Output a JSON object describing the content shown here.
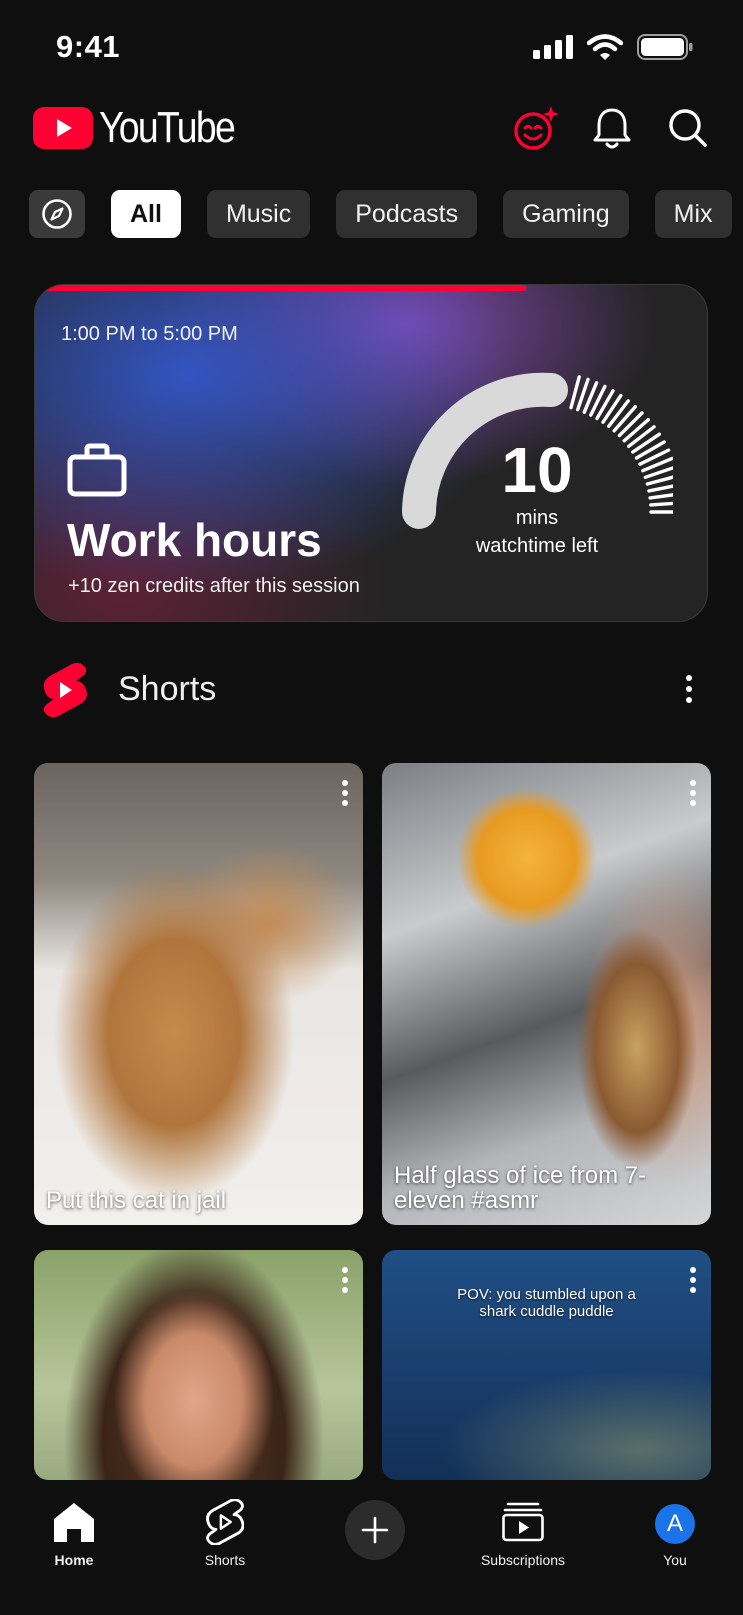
{
  "status_bar": {
    "time": "9:41"
  },
  "header": {
    "logo_text": "YouTube"
  },
  "chips": [
    {
      "label": "All",
      "active": true
    },
    {
      "label": "Music"
    },
    {
      "label": "Podcasts"
    },
    {
      "label": "Gaming"
    },
    {
      "label": "Mix"
    }
  ],
  "work_card": {
    "time_range": "1:00 PM to 5:00 PM",
    "title": "Work hours",
    "subtitle": "+10 zen credits after this session",
    "remaining_value": "10",
    "remaining_unit": "mins",
    "remaining_label": "watchtime left",
    "session_progress": 0.73,
    "accent_color": "#ff0033"
  },
  "shorts": {
    "title": "Shorts",
    "items": [
      {
        "title": "Put this cat in jail"
      },
      {
        "title": "Half glass of ice from 7-eleven #asmr"
      },
      {
        "title": ""
      },
      {
        "overlay_text": "POV: you stumbled upon a shark cuddle puddle"
      }
    ]
  },
  "bottom_nav": {
    "home": "Home",
    "shorts": "Shorts",
    "subscriptions": "Subscriptions",
    "you": "You",
    "avatar_initial": "A"
  }
}
